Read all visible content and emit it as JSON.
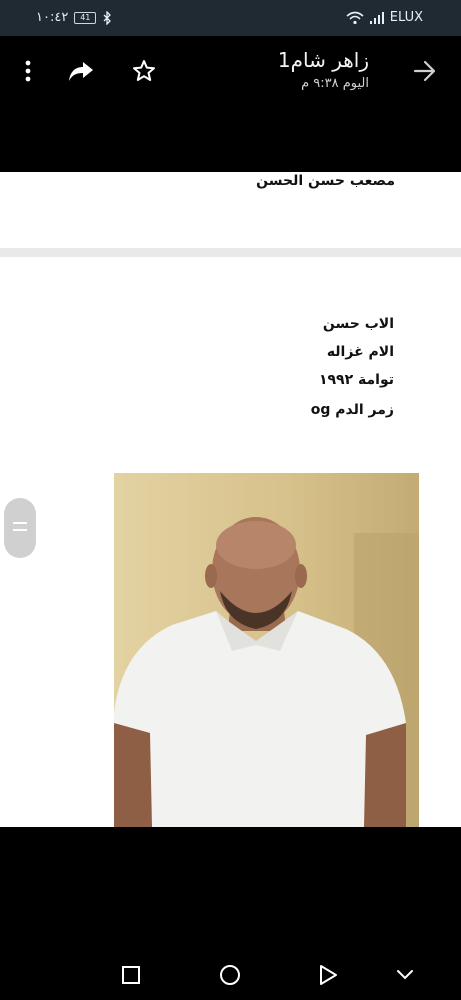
{
  "status_bar": {
    "time": "١٠:٤٢",
    "battery": "41",
    "carrier": "ELUX"
  },
  "header": {
    "title": "زاهر شام1",
    "subtitle": "اليوم ٩:٣٨ م",
    "icons": [
      "more-vert-icon",
      "share-icon",
      "star-icon",
      "forward-arrow-icon"
    ]
  },
  "document": {
    "page1_text": "مصعب حسن الحسن",
    "lines": [
      "الاب حسن",
      "الام غزاله",
      "توامة ١٩٩٢",
      "زمر الدم og"
    ]
  },
  "nav": {
    "icons": [
      "recents-square-icon",
      "home-circle-icon",
      "back-triangle-icon",
      "chevron-down-icon"
    ]
  },
  "colors": {
    "status_bg": "#1f2a33",
    "page_bg": "#ffffff",
    "photo_wall": "#d9c592"
  }
}
